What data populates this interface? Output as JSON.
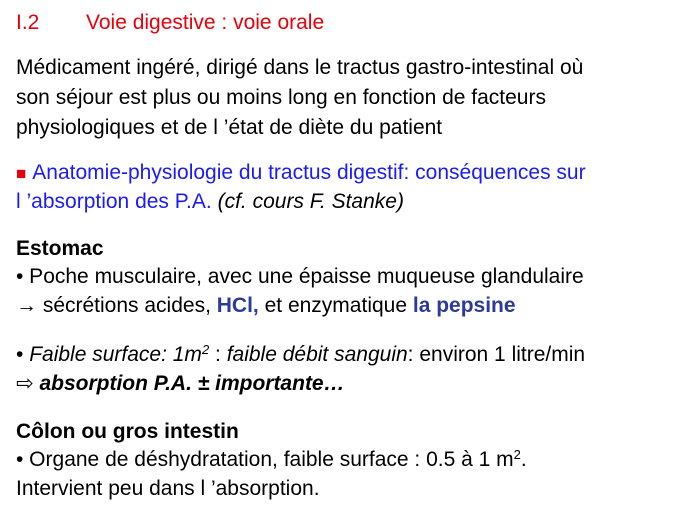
{
  "title": {
    "number": "I.2",
    "text": "Voie digestive : voie orale"
  },
  "intro": [
    "Médicament ingéré, dirigé dans le tractus gastro-intestinal où",
    "son séjour est plus ou moins long en fonction de facteurs",
    "physiologiques et de l ’état de diète du patient"
  ],
  "anatomy": {
    "bullet": "■",
    "line1": "Anatomie-physiologie du tractus digestif: conséquences sur",
    "line2_blue": "l ’absorption des P.A.",
    "line2_ref": "(cf. cours F. Stanke)"
  },
  "estomac": {
    "heading": "Estomac",
    "bullet1_line1": "• Poche musculaire, avec une épaisse muqueuse glandulaire",
    "bullet1_line2_arrow": "→",
    "bullet1_line2_a": " sécrétions acides, ",
    "bullet1_line2_hcl": "HCl,",
    "bullet1_line2_b": " et enzymatique ",
    "bullet1_line2_pepsine": "la pepsine",
    "bullet2_dot": "• ",
    "bullet2_italic": "Faible surface: 1m",
    "bullet2_sup": "2",
    "bullet2_mid": " : ",
    "bullet2_italic2": "faible débit sanguin",
    "bullet2_end": ": environ 1 litre/min",
    "bullet3_arrow": "⇨",
    "bullet3_text": " absorption P.A. ± importante…"
  },
  "colon": {
    "heading": "Côlon ou gros intestin",
    "bullet1_a": "• Organe de déshydratation, faible surface : 0.5 à 1 m",
    "bullet1_sup": "2",
    "bullet1_b": ".",
    "line2": "Intervient peu dans l ’absorption."
  },
  "colors": {
    "title": "#e8000b",
    "blue": "#1a1aff",
    "navy": "#2c3a9c",
    "text": "#000000"
  }
}
